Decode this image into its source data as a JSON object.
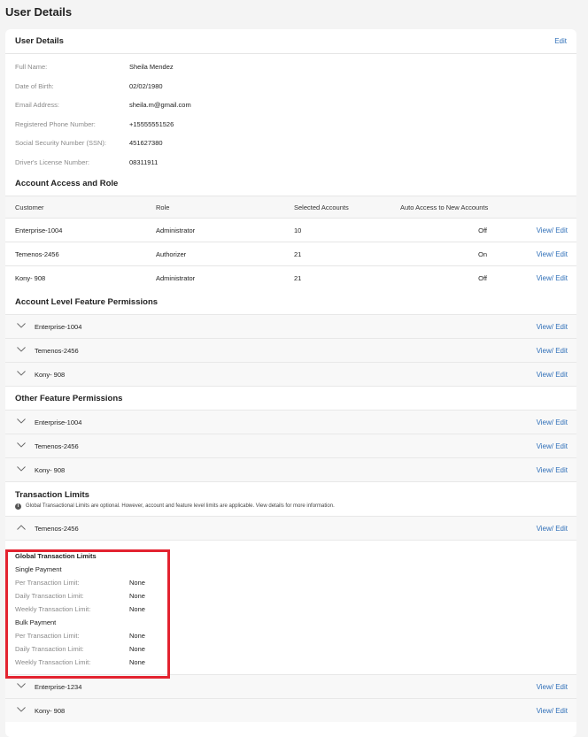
{
  "page_title": "User Details",
  "user_details": {
    "title": "User Details",
    "edit_label": "Edit",
    "fields": [
      {
        "label": "Full Name:",
        "value": "Sheila Mendez"
      },
      {
        "label": "Date of Birth:",
        "value": "02/02/1980"
      },
      {
        "label": "Email Address:",
        "value": "sheila.m@gmail.com"
      },
      {
        "label": "Registered Phone Number:",
        "value": "+15555551526"
      },
      {
        "label": "Social Security Number (SSN):",
        "value": "451627380"
      },
      {
        "label": "Driver's License Number:",
        "value": "08311911"
      }
    ]
  },
  "account_access": {
    "title": "Account Access and Role",
    "headers": [
      "Customer",
      "Role",
      "Selected Accounts",
      "Auto Access to New Accounts"
    ],
    "rows": [
      {
        "customer": "Enterprise-1004",
        "role": "Administrator",
        "accounts": "10",
        "auto": "Off",
        "action": "View/ Edit"
      },
      {
        "customer": "Temenos-2456",
        "role": "Authorizer",
        "accounts": "21",
        "auto": "On",
        "action": "View/ Edit"
      },
      {
        "customer": "Kony- 908",
        "role": "Administrator",
        "accounts": "21",
        "auto": "Off",
        "action": "View/ Edit"
      }
    ]
  },
  "account_feature": {
    "title": "Account Level Feature Permissions",
    "items": [
      {
        "name": "Enterprise-1004",
        "action": "View/ Edit"
      },
      {
        "name": "Temenos-2456",
        "action": "View/ Edit"
      },
      {
        "name": "Kony- 908",
        "action": "View/ Edit"
      }
    ]
  },
  "other_feature": {
    "title": "Other Feature Permissions",
    "items": [
      {
        "name": "Enterprise-1004",
        "action": "View/ Edit"
      },
      {
        "name": "Temenos-2456",
        "action": "View/ Edit"
      },
      {
        "name": "Kony- 908",
        "action": "View/ Edit"
      }
    ]
  },
  "transaction_limits": {
    "title": "Transaction Limits",
    "info_icon": "info-icon",
    "info": "Global Transactional Limits are optional. However, account and feature level limits are applicable. View details for more information.",
    "expanded": {
      "name": "Temenos-2456",
      "action": "View/ Edit"
    },
    "global": {
      "title": "Global Transaction Limits",
      "single": "Single Payment",
      "bulk": "Bulk Payment",
      "labels": [
        "Per Transaction Limit:",
        "Daily Transaction Limit:",
        "Weekly Transaction Limit:"
      ],
      "single_values": [
        "None",
        "None",
        "None"
      ],
      "bulk_values": [
        "None",
        "None",
        "None"
      ]
    },
    "others": [
      {
        "name": "Enterprise-1234",
        "action": "View/ Edit"
      },
      {
        "name": "Kony- 908",
        "action": "View/ Edit"
      }
    ]
  },
  "colors": {
    "link": "#2f6fb8",
    "highlight": "#e32330"
  }
}
